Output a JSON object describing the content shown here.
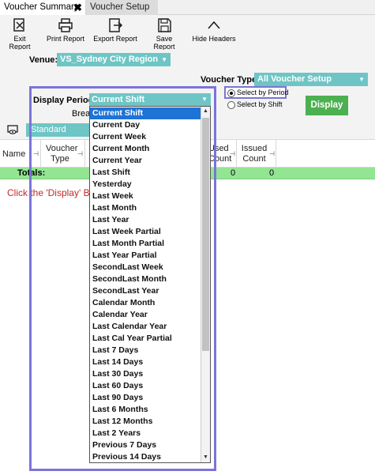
{
  "tabs": [
    {
      "label": "Voucher Summary",
      "close": "✖"
    },
    {
      "label": "Voucher Setup"
    }
  ],
  "toolbar": {
    "exit_report": "Exit Report",
    "print_report": "Print Report",
    "export_report": "Export Report",
    "save_report": "Save Report",
    "hide_headers": "Hide Headers"
  },
  "filters": {
    "venue_label": "Venue:",
    "venue_value": "VS_Sydney City Region",
    "voucher_type_label": "Voucher Type:",
    "voucher_type_value": "All Voucher Setup",
    "display_period_label": "Display Period:",
    "display_period_value": "Current Shift",
    "breakdown_label": "Brea",
    "select_by_period": "Select by Period",
    "select_by_shift": "Select by Shift",
    "display_button": "Display"
  },
  "layout": {
    "view_name": "Standard"
  },
  "grid": {
    "columns": [
      "Name",
      "Voucher Type",
      "Used Count",
      "Issued Count"
    ],
    "col_used_partial": "Used\nCount",
    "totals_label": "Totals:",
    "totals_used": "0",
    "totals_issued": "0"
  },
  "hint": "Click the 'Display' Bu",
  "period_options": [
    "Current Shift",
    "Current Day",
    "Current Week",
    "Current Month",
    "Current Year",
    "Last Shift",
    "Yesterday",
    "Last Week",
    "Last Month",
    "Last Year",
    "Last Week Partial",
    "Last Month Partial",
    "Last Year Partial",
    "SecondLast Week",
    "SecondLast Month",
    "SecondLast Year",
    "Calendar Month",
    "Calendar Year",
    "Last Calendar Year",
    "Last Cal Year Partial",
    "Last 7 Days",
    "Last 14 Days",
    "Last 30 Days",
    "Last 60 Days",
    "Last 90 Days",
    "Last 6 Months",
    "Last 12 Months",
    "Last 2 Years",
    "Previous 7 Days",
    "Previous 14 Days"
  ],
  "selected_period_index": 0,
  "colors": {
    "accent": "#6fc5c5",
    "display_button": "#4cb050",
    "totals_row": "#93e593",
    "selection": "#1e73d6",
    "focus_frame": "#7b74d8",
    "hint_text": "#c62828"
  },
  "icons": [
    "close-icon",
    "exit-report-icon",
    "printer-icon",
    "export-icon",
    "save-icon",
    "chevron-up-icon",
    "eye-icon",
    "pin-icon"
  ]
}
